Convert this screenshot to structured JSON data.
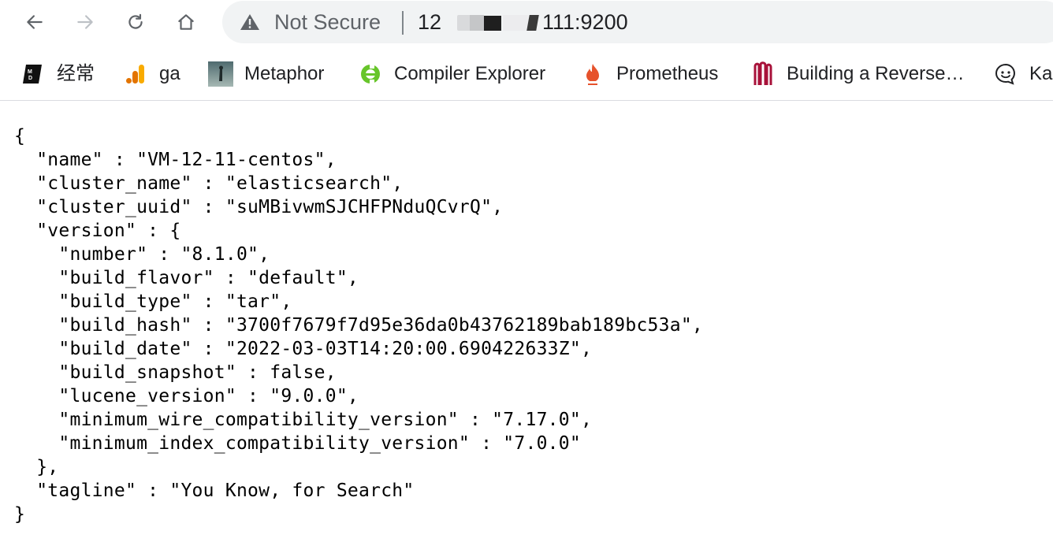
{
  "toolbar": {
    "security_label": "Not Secure",
    "url_prefix": "12",
    "url_suffix": "111:9200"
  },
  "bookmarks": [
    {
      "label": "经常",
      "icon": "markdown-notes-icon"
    },
    {
      "label": "ga",
      "icon": "analytics-bars-icon"
    },
    {
      "label": "Metaphor",
      "icon": "metaphor-thumbnail-icon"
    },
    {
      "label": "Compiler Explorer",
      "icon": "compiler-explorer-icon"
    },
    {
      "label": "Prometheus",
      "icon": "prometheus-flame-icon"
    },
    {
      "label": "Building a Reverse…",
      "icon": "red-m-logo-icon"
    },
    {
      "label": "Ka",
      "icon": "chat-bubble-icon"
    }
  ],
  "json_text": "{\n  \"name\" : \"VM-12-11-centos\",\n  \"cluster_name\" : \"elasticsearch\",\n  \"cluster_uuid\" : \"suMBivwmSJCHFPNduQCvrQ\",\n  \"version\" : {\n    \"number\" : \"8.1.0\",\n    \"build_flavor\" : \"default\",\n    \"build_type\" : \"tar\",\n    \"build_hash\" : \"3700f7679f7d95e36da0b43762189bab189bc53a\",\n    \"build_date\" : \"2022-03-03T14:20:00.690422633Z\",\n    \"build_snapshot\" : false,\n    \"lucene_version\" : \"9.0.0\",\n    \"minimum_wire_compatibility_version\" : \"7.17.0\",\n    \"minimum_index_compatibility_version\" : \"7.0.0\"\n  },\n  \"tagline\" : \"You Know, for Search\"\n}"
}
